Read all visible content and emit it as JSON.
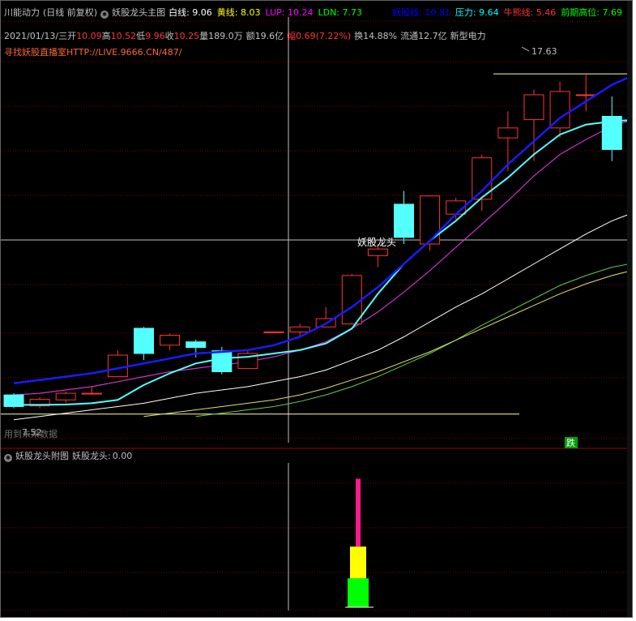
{
  "header": {
    "indicator_name": "川能动力",
    "period": "(日线 前复权)",
    "main_chart_title": "妖股龙头主图",
    "lines": [
      {
        "label": "白线",
        "value": "9.06",
        "color": "#ffffff"
      },
      {
        "label": "黄线",
        "value": "8.03",
        "color": "#ffff00"
      },
      {
        "label": "LUP",
        "value": "10.24",
        "color": "#ff00ff"
      },
      {
        "label": "LDN",
        "value": "7.73",
        "color": "#00ff00"
      }
    ],
    "right_lines": [
      {
        "label": "妖股线",
        "value": "10.81",
        "color": "#0000ff"
      },
      {
        "label": "压力",
        "value": "9.64",
        "color": "#00ffff"
      },
      {
        "label": "牛熊线",
        "value": "5.46",
        "color": "#ff3333"
      },
      {
        "label": "前期高位",
        "value": "7.69",
        "color": "#00ff00"
      }
    ]
  },
  "quote": {
    "date": "2021/01/13/三",
    "open_label": "开",
    "open": "10.09",
    "high_label": "高",
    "high": "10.52",
    "low_label": "低",
    "low": "9.96",
    "close_label": "收",
    "close": "10.25",
    "volume_label": "量",
    "volume": "189.0万",
    "amount_label": "额",
    "amount": "19.6亿",
    "change_label": "幅",
    "change": "0.69(7.22%)",
    "turnover_label": "换",
    "turnover": "14.88%",
    "float_label": "流通",
    "float": "12.7亿",
    "sector": "新型电力"
  },
  "ad_text": "寻找妖股直播室HTTP://LIVE.9666.CN/487/",
  "chart_labels": {
    "high_marker": "17.63",
    "low_marker": "7.52",
    "watermark": "用到未来数据",
    "dragon_label": "妖股龙头",
    "fall_badge": "跌"
  },
  "sub_header": {
    "title": "妖股龙头附图",
    "label": "妖股龙头",
    "value": "0.00"
  },
  "colors": {
    "up": "#ff3333",
    "down": "#54ffff",
    "blue_line": "#1a1aff",
    "cyan_line": "#54ffff",
    "magenta_line": "#cc33cc",
    "white_line": "#ffffff",
    "yellow_line": "#e0e070",
    "green_line": "#66cc44",
    "grid": "#800000"
  },
  "chart_data": {
    "type": "candlestick",
    "ylim": [
      7.0,
      18.0
    ],
    "candles": [
      {
        "o": 7.95,
        "h": 8.0,
        "l": 7.55,
        "c": 7.6
      },
      {
        "o": 7.62,
        "h": 7.88,
        "l": 7.55,
        "c": 7.82
      },
      {
        "o": 7.8,
        "h": 8.05,
        "l": 7.7,
        "c": 8.0
      },
      {
        "o": 8.0,
        "h": 8.2,
        "l": 7.95,
        "c": 8.0
      },
      {
        "o": 8.5,
        "h": 9.3,
        "l": 8.5,
        "c": 9.15
      },
      {
        "o": 9.96,
        "h": 10.0,
        "l": 9.0,
        "c": 9.2
      },
      {
        "o": 9.45,
        "h": 9.8,
        "l": 9.3,
        "c": 9.75
      },
      {
        "o": 9.55,
        "h": 9.62,
        "l": 9.08,
        "c": 9.38
      },
      {
        "o": 9.28,
        "h": 9.4,
        "l": 8.57,
        "c": 8.65
      },
      {
        "o": 8.75,
        "h": 9.3,
        "l": 8.75,
        "c": 9.2
      },
      {
        "o": 9.85,
        "h": 9.85,
        "l": 9.85,
        "c": 9.85
      },
      {
        "o": 9.85,
        "h": 10.1,
        "l": 9.7,
        "c": 10.0
      },
      {
        "o": 10.0,
        "h": 10.6,
        "l": 10.0,
        "c": 10.25
      },
      {
        "o": 10.09,
        "h": 11.6,
        "l": 10.09,
        "c": 11.55
      },
      {
        "o": 12.15,
        "h": 12.5,
        "l": 11.8,
        "c": 12.35
      },
      {
        "o": 13.7,
        "h": 14.1,
        "l": 12.5,
        "c": 12.7
      },
      {
        "o": 12.5,
        "h": 13.95,
        "l": 12.3,
        "c": 13.95
      },
      {
        "o": 13.4,
        "h": 13.9,
        "l": 13.25,
        "c": 13.8
      },
      {
        "o": 13.85,
        "h": 15.2,
        "l": 13.5,
        "c": 15.1
      },
      {
        "o": 15.7,
        "h": 16.5,
        "l": 14.7,
        "c": 16.0
      },
      {
        "o": 16.25,
        "h": 17.15,
        "l": 15.0,
        "c": 17.0
      },
      {
        "o": 16.0,
        "h": 17.4,
        "l": 15.7,
        "c": 17.1
      },
      {
        "o": 17.0,
        "h": 17.63,
        "l": 16.5,
        "c": 17.0
      },
      {
        "o": 16.35,
        "h": 16.95,
        "l": 15.0,
        "c": 15.35
      },
      {
        "o": 15.95,
        "h": 15.95,
        "l": 14.3,
        "c": 15.95
      },
      {
        "o": 15.7,
        "h": 15.7,
        "l": 14.7,
        "c": 14.75
      }
    ],
    "sub_chart": {
      "stack": [
        {
          "name": "magenta",
          "from": 4.2,
          "to": 8.9,
          "color": "#ff1a8c"
        },
        {
          "name": "yellow",
          "from": 2.0,
          "to": 4.2,
          "color": "#ffff00"
        },
        {
          "name": "green",
          "from": 0.0,
          "to": 2.0,
          "color": "#00ff00"
        }
      ],
      "ylim": [
        0,
        10
      ]
    }
  }
}
